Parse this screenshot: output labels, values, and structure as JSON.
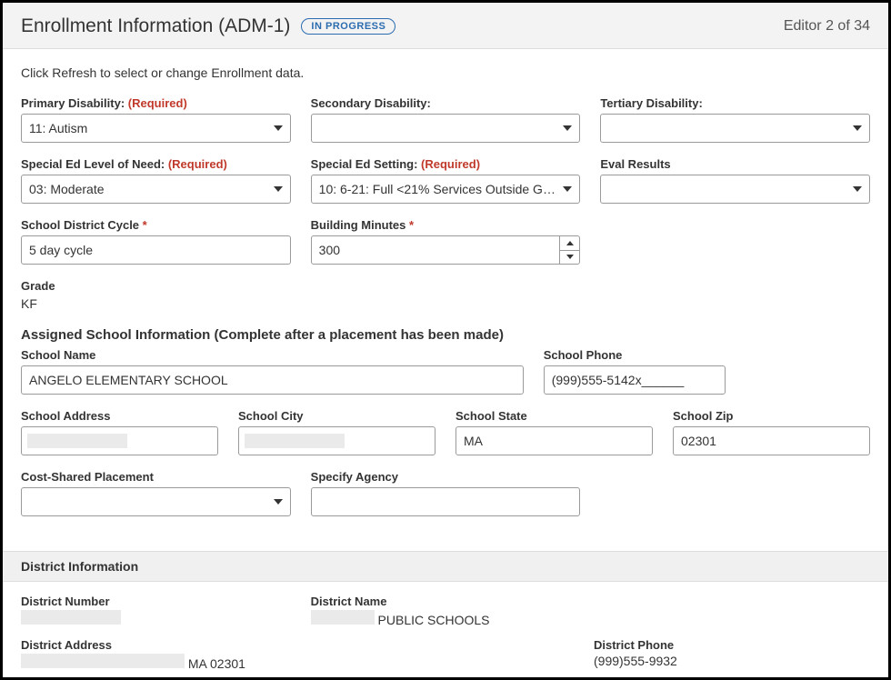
{
  "header": {
    "title": "Enrollment Information (ADM-1)",
    "status": "IN PROGRESS",
    "editor_count": "Editor 2 of 34"
  },
  "instruction": "Click Refresh to select or change Enrollment data.",
  "fields": {
    "primary_disability": {
      "label": "Primary Disability:",
      "required": "(Required)",
      "value": "11: Autism"
    },
    "secondary_disability": {
      "label": "Secondary Disability:",
      "value": ""
    },
    "tertiary_disability": {
      "label": "Tertiary Disability:",
      "value": ""
    },
    "sped_level": {
      "label": "Special Ed Level of Need:",
      "required": "(Required)",
      "value": "03: Moderate"
    },
    "sped_setting": {
      "label": "Special Ed Setting:",
      "required": "(Required)",
      "value": "10: 6-21: Full <21% Services Outside G…"
    },
    "eval_results": {
      "label": "Eval Results",
      "value": ""
    },
    "district_cycle": {
      "label": "School District Cycle",
      "value": "5 day cycle"
    },
    "building_minutes": {
      "label": "Building Minutes",
      "value": "300"
    },
    "grade": {
      "label": "Grade",
      "value": "KF"
    }
  },
  "assigned_school": {
    "heading": "Assigned School Information (Complete after a placement has been made)",
    "name": {
      "label": "School Name",
      "value": "ANGELO ELEMENTARY SCHOOL"
    },
    "phone": {
      "label": "School Phone",
      "value": "(999)555-5142x______"
    },
    "address": {
      "label": "School Address",
      "value": ""
    },
    "city": {
      "label": "School City",
      "value": ""
    },
    "state": {
      "label": "School State",
      "value": "MA"
    },
    "zip": {
      "label": "School Zip",
      "value": "02301"
    },
    "cost_shared": {
      "label": "Cost-Shared Placement",
      "value": ""
    },
    "specify_agency": {
      "label": "Specify Agency",
      "value": ""
    }
  },
  "district": {
    "heading": "District Information",
    "number": {
      "label": "District Number",
      "value": ""
    },
    "name": {
      "label": "District Name",
      "value": "PUBLIC SCHOOLS",
      "prefix_redacted": true
    },
    "address": {
      "label": "District Address",
      "suffix": "MA 02301"
    },
    "phone": {
      "label": "District Phone",
      "value": "(999)555-9932"
    }
  }
}
